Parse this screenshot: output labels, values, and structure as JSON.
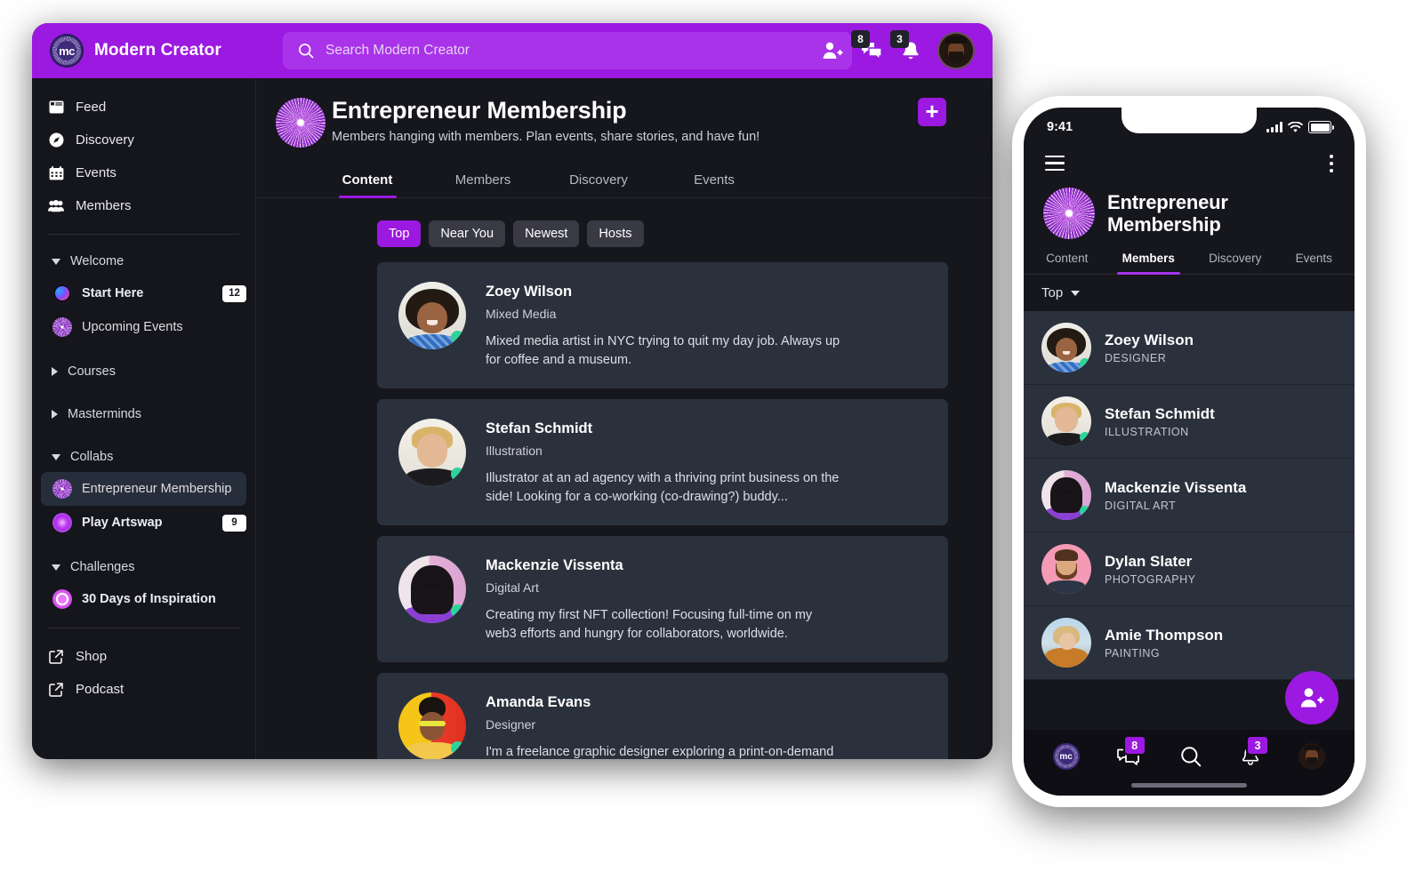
{
  "desktop": {
    "topbar": {
      "brand_name": "Modern Creator",
      "logo_text": "mc",
      "search_placeholder": "Search Modern Creator",
      "search_value": "",
      "invite_icon": "add-person-icon",
      "messages_icon": "chat-bubbles-icon",
      "messages_badge": "8",
      "notifications_icon": "bell-icon",
      "notifications_badge": "3",
      "avatar_icon": "user-avatar"
    },
    "sidebar": {
      "primary": [
        {
          "label": "Feed",
          "icon": "feed-icon"
        },
        {
          "label": "Discovery",
          "icon": "compass-icon"
        },
        {
          "label": "Events",
          "icon": "calendar-icon"
        },
        {
          "label": "Members",
          "icon": "people-icon"
        }
      ],
      "groups": [
        {
          "label": "Welcome",
          "expanded": true,
          "items": [
            {
              "label": "Start Here",
              "badge": "12",
              "avatar": "gradient-ring-avatar",
              "has_marker": true
            },
            {
              "label": "Upcoming Events",
              "badge": "",
              "avatar": "burst-avatar",
              "has_marker": false
            }
          ]
        },
        {
          "label": "Courses",
          "expanded": false,
          "items": []
        },
        {
          "label": "Masterminds",
          "expanded": false,
          "items": []
        },
        {
          "label": "Collabs",
          "expanded": true,
          "items": [
            {
              "label": "Entrepreneur Membership",
              "badge": "",
              "avatar": "burst-avatar",
              "has_marker": false,
              "active": true
            },
            {
              "label": "Play Artswap",
              "badge": "9",
              "avatar": "purple-radial-avatar",
              "has_marker": true
            }
          ]
        },
        {
          "label": "Challenges",
          "expanded": true,
          "items": [
            {
              "label": "30 Days of Inspiration",
              "badge": "",
              "avatar": "pink-ring-avatar",
              "has_marker": true
            }
          ]
        }
      ],
      "footer": [
        {
          "label": "Shop",
          "icon": "external-link-icon"
        },
        {
          "label": "Podcast",
          "icon": "external-link-icon"
        }
      ]
    },
    "community": {
      "title": "Entrepreneur Membership",
      "subtitle": "Members hanging with members. Plan events, share stories, and have fun!",
      "add_button_label": "+",
      "logo_icon": "burst-logo",
      "tabs": [
        {
          "label": "Content",
          "active": true
        },
        {
          "label": "Members",
          "active": false
        },
        {
          "label": "Discovery",
          "active": false
        },
        {
          "label": "Events",
          "active": false
        }
      ],
      "filters": [
        {
          "label": "Top",
          "active": true
        },
        {
          "label": "Near You",
          "active": false
        },
        {
          "label": "Newest",
          "active": false
        },
        {
          "label": "Hosts",
          "active": false
        }
      ],
      "members": [
        {
          "name": "Zoey Wilson",
          "role": "Mixed Media",
          "bio": "Mixed media artist in NYC trying to quit my day job. Always up for coffee and a museum.",
          "online": true,
          "avatar": "zoey"
        },
        {
          "name": "Stefan Schmidt",
          "role": "Illustration",
          "bio": "Illustrator at an ad agency with a thriving print business on the side! Looking for a co-working (co-drawing?) buddy...",
          "online": true,
          "avatar": "stefan"
        },
        {
          "name": "Mackenzie Vissenta",
          "role": "Digital Art",
          "bio": "Creating my first NFT collection! Focusing full-time on my web3 efforts and hungry for collaborators, worldwide.",
          "online": true,
          "avatar": "mack"
        },
        {
          "name": "Amanda Evans",
          "role": "Designer",
          "bio": "I'm a freelance graphic designer exploring a print-on-demand business.",
          "online": true,
          "avatar": "amanda"
        }
      ]
    }
  },
  "mobile": {
    "statusbar": {
      "time": "9:41",
      "signal_icon": "cellular-bars-icon",
      "wifi_icon": "wifi-icon",
      "battery_icon": "battery-icon"
    },
    "topnav": {
      "menu_icon": "hamburger-menu-icon",
      "more_icon": "kebab-menu-icon"
    },
    "community": {
      "title": "Entrepreneur Membership",
      "logo_icon": "burst-logo"
    },
    "tabs": [
      {
        "label": "Content",
        "active": false
      },
      {
        "label": "Members",
        "active": true
      },
      {
        "label": "Discovery",
        "active": false
      },
      {
        "label": "Events",
        "active": false
      }
    ],
    "sort": {
      "label": "Top",
      "icon": "chevron-down-icon"
    },
    "members": [
      {
        "name": "Zoey Wilson",
        "role": "DESIGNER",
        "online": true,
        "avatar": "zoey"
      },
      {
        "name": "Stefan Schmidt",
        "role": "ILLUSTRATION",
        "online": true,
        "avatar": "stefan"
      },
      {
        "name": "Mackenzie Vissenta",
        "role": "DIGITAL ART",
        "online": true,
        "avatar": "mack"
      },
      {
        "name": "Dylan Slater",
        "role": "PHOTOGRAPHY",
        "online": false,
        "avatar": "dylan"
      },
      {
        "name": "Amie Thompson",
        "role": "PAINTING",
        "online": false,
        "avatar": "amie"
      }
    ],
    "fab": {
      "icon": "add-person-icon"
    },
    "bottomnav": [
      {
        "icon": "mc-logo-icon",
        "badge": ""
      },
      {
        "icon": "chat-bubbles-icon",
        "badge": "8"
      },
      {
        "icon": "search-icon",
        "badge": ""
      },
      {
        "icon": "bell-icon",
        "badge": "3"
      },
      {
        "icon": "user-avatar",
        "badge": ""
      }
    ]
  },
  "colors": {
    "brand_purple": "#9b19e0",
    "topbar_purple": "#9b19e0",
    "search_purple": "#a933e8",
    "app_bg": "#16161d",
    "sidebar_bg": "#15151c",
    "card_bg": "#2b313c",
    "active_item_bg": "#272e3b",
    "online_green": "#2dd49a",
    "badge_dark": "#22222c"
  }
}
